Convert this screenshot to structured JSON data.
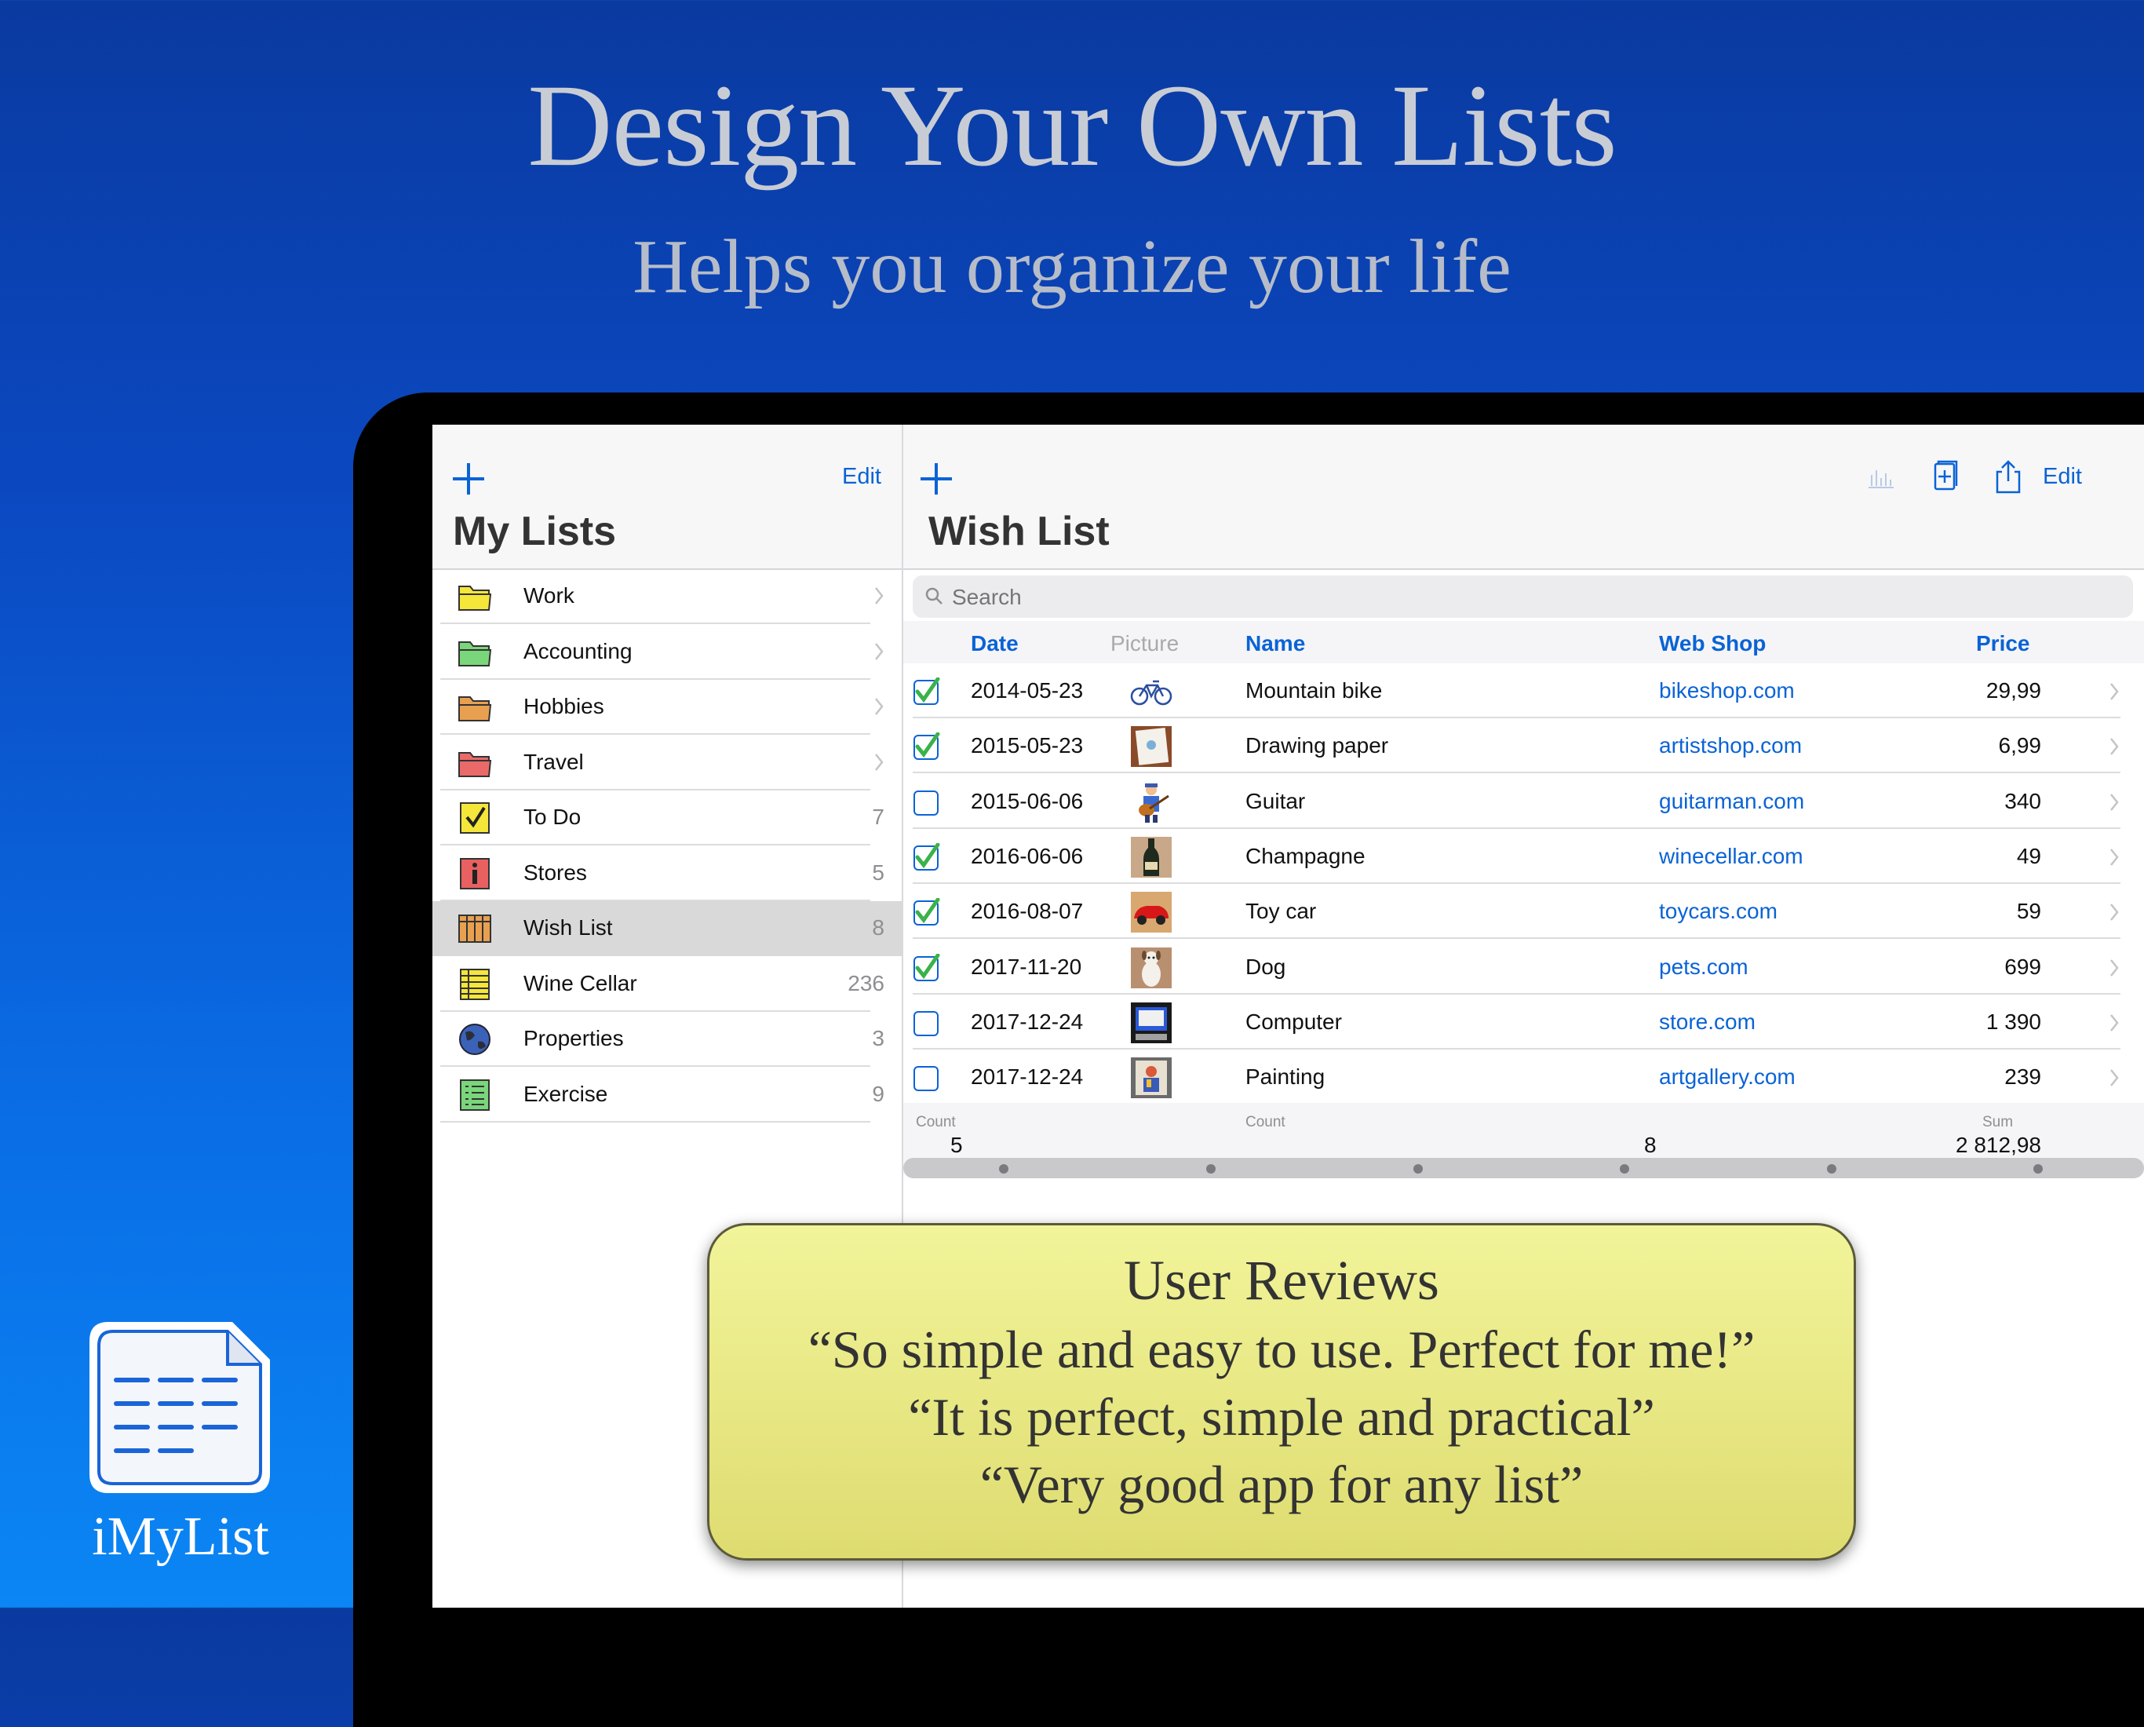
{
  "marketing": {
    "headline": "Design Your Own Lists",
    "subheadline": "Helps you organize your life",
    "app_name": "iMyList"
  },
  "sidebar": {
    "edit_label": "Edit",
    "title": "My Lists",
    "items": [
      {
        "label": "Work",
        "count": "",
        "icon": "folder-yellow-icon",
        "color": "#f5e63a"
      },
      {
        "label": "Accounting",
        "count": "",
        "icon": "folder-green-icon",
        "color": "#7ad67a"
      },
      {
        "label": "Hobbies",
        "count": "",
        "icon": "folder-orange-icon",
        "color": "#e8a050"
      },
      {
        "label": "Travel",
        "count": "",
        "icon": "folder-red-icon",
        "color": "#ea6a6a"
      },
      {
        "label": "To Do",
        "count": "7",
        "icon": "checkbox-list-icon",
        "color": "#f5e63a"
      },
      {
        "label": "Stores",
        "count": "5",
        "icon": "info-icon",
        "color": "#e86060"
      },
      {
        "label": "Wish List",
        "count": "8",
        "icon": "table-grid-icon",
        "color": "#e8a050"
      },
      {
        "label": "Wine Cellar",
        "count": "236",
        "icon": "spreadsheet-icon",
        "color": "#f5e63a"
      },
      {
        "label": "Properties",
        "count": "3",
        "icon": "globe-icon",
        "color": "#3a62b8"
      },
      {
        "label": "Exercise",
        "count": "9",
        "icon": "checklist-icon",
        "color": "#7ad67a"
      }
    ],
    "selected_index": 6
  },
  "detail": {
    "title": "Wish List",
    "edit_label": "Edit",
    "search_placeholder": "Search",
    "columns": {
      "date": "Date",
      "picture": "Picture",
      "name": "Name",
      "web_shop": "Web Shop",
      "price": "Price"
    },
    "rows": [
      {
        "checked": true,
        "date": "2014-05-23",
        "picture": "bicycle-icon",
        "name": "Mountain bike",
        "shop": "bikeshop.com",
        "price": "29,99"
      },
      {
        "checked": true,
        "date": "2015-05-23",
        "picture": "drawing-paper-icon",
        "name": "Drawing paper",
        "shop": "artistshop.com",
        "price": "6,99"
      },
      {
        "checked": false,
        "date": "2015-06-06",
        "picture": "guitar-player-icon",
        "name": "Guitar",
        "shop": "guitarman.com",
        "price": "340"
      },
      {
        "checked": true,
        "date": "2016-06-06",
        "picture": "champagne-bottle-icon",
        "name": "Champagne",
        "shop": "winecellar.com",
        "price": "49"
      },
      {
        "checked": true,
        "date": "2016-08-07",
        "picture": "toy-car-icon",
        "name": "Toy car",
        "shop": "toycars.com",
        "price": "59"
      },
      {
        "checked": true,
        "date": "2017-11-20",
        "picture": "dog-icon",
        "name": "Dog",
        "shop": "pets.com",
        "price": "699"
      },
      {
        "checked": false,
        "date": "2017-12-24",
        "picture": "computer-icon",
        "name": "Computer",
        "shop": "store.com",
        "price": "1 390"
      },
      {
        "checked": false,
        "date": "2017-12-24",
        "picture": "painting-icon",
        "name": "Painting",
        "shop": "artgallery.com",
        "price": "239"
      }
    ],
    "footer": {
      "count_label_1": "Count",
      "count_value_1": "5",
      "count_label_2": "Count",
      "count_value_2": "8",
      "sum_label": "Sum",
      "sum_value": "2 812,98"
    }
  },
  "reviews": {
    "title": "User Reviews",
    "lines": [
      "“So simple and easy to use. Perfect for me!”",
      "“It is perfect, simple and practical”",
      "“Very good app for any list”"
    ]
  },
  "colors": {
    "accent": "#0a63d6",
    "check_green": "#3ab24a",
    "review_bg": "#ecec8a"
  }
}
